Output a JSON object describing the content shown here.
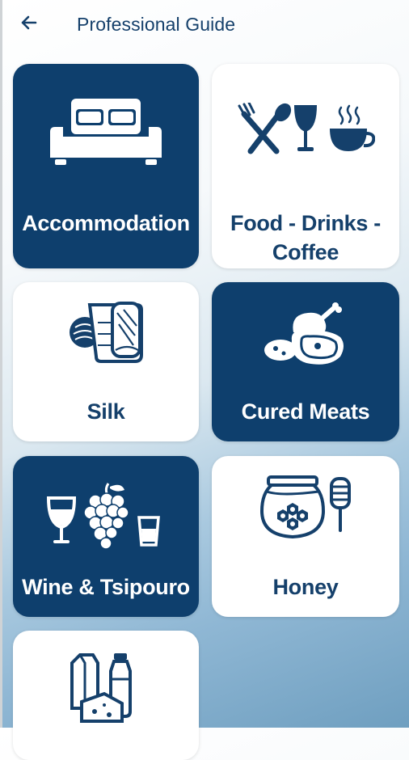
{
  "header": {
    "title": "Professional Guide"
  },
  "tiles": [
    {
      "label": "Accommodation",
      "icon": "bed-icon",
      "style": "dark"
    },
    {
      "label_line1": "Food - Drinks -",
      "label_line2": "Coffee",
      "icon": "food-drinks-coffee-icon",
      "style": "light"
    },
    {
      "label": "Silk",
      "icon": "silk-fabric-icon",
      "style": "light"
    },
    {
      "label": "Cured Meats",
      "icon": "cured-meats-icon",
      "style": "dark"
    },
    {
      "label": "Wine & Tsipouro",
      "icon": "wine-grapes-icon",
      "style": "dark"
    },
    {
      "label": "Honey",
      "icon": "honey-jar-icon",
      "style": "light"
    },
    {
      "label": "",
      "icon": "dairy-products-icon",
      "style": "light"
    }
  ],
  "colors": {
    "primary": "#0e3f6d",
    "text_dark": "#15406b",
    "tile_light": "#ffffff"
  }
}
